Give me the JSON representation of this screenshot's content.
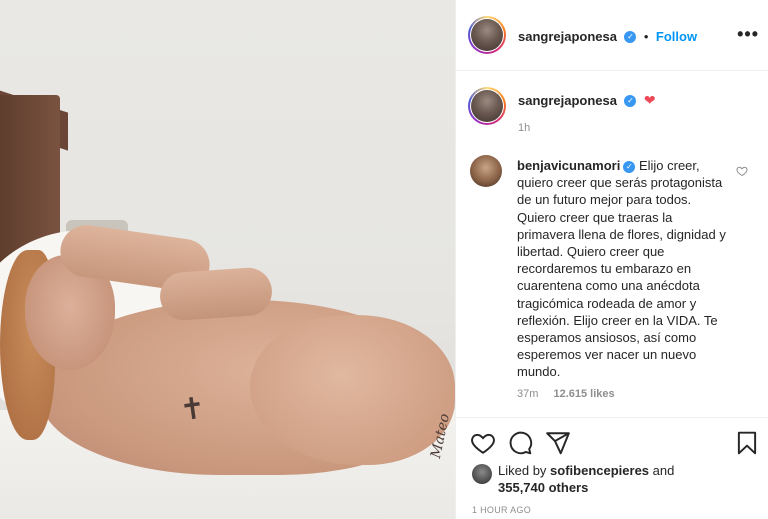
{
  "header": {
    "username": "sangrejaponesa",
    "dot": "•",
    "follow_label": "Follow",
    "more_label": "•••"
  },
  "caption": {
    "username": "sangrejaponesa",
    "emoji": "❤",
    "time": "1h"
  },
  "comment": {
    "username": "benjavicunamori",
    "text": "Elijo creer, quiero creer que serás protagonista de un futuro mejor para todos. Quiero creer que traeras la primavera llena de flores, dignidad y libertad. Quiero creer que recordaremos tu embarazo en cuarentena como una anécdota tragicómica rodeada de amor y reflexión. Elijo creer en la VIDA. Te esperamos ansiosos, así como esperemos ver nacer un nuevo mundo.",
    "time": "37m",
    "likes": "12.615 likes"
  },
  "likes": {
    "prefix": "Liked by",
    "user": "sofibencepieres",
    "middle": "and",
    "count": "355,740 others"
  },
  "timestamp": "1 HOUR AGO",
  "colors": {
    "accent": "#0095f6",
    "verified": "#3897f0",
    "heart": "#ed4956",
    "muted": "#8e8e8e"
  },
  "icons": [
    "verified-badge-icon",
    "more-options-icon",
    "heart-icon",
    "comment-icon",
    "share-icon",
    "bookmark-icon"
  ]
}
